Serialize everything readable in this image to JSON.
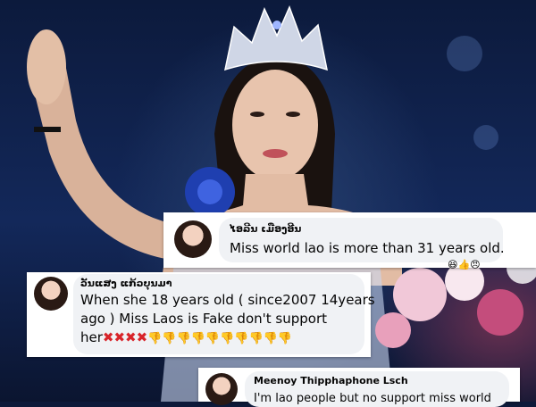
{
  "comments": [
    {
      "name": "ໄອລີນ ເມືອງອີນ",
      "text": "Miss world lao is more than 31 years old."
    },
    {
      "name": "ວັນແສງ ແກ້ວບຸນມາ",
      "text_line1": "When she 18 years old ( since2007 14years",
      "text_line2": "ago ) Miss Laos is Fake don't support",
      "text_line3": "her",
      "x_marks": "✖✖✖✖",
      "thumbs_down": "👎👎👎👎👎👎👎👎👎👎"
    },
    {
      "name": "Meenoy Thipphaphone Lsch",
      "text": "I'm lao people but no support miss world"
    }
  ],
  "icons": {
    "reaction_icons": [
      "haha-icon",
      "like-icon",
      "angry-icon"
    ]
  },
  "colors": {
    "bubble": "#f0f2f5",
    "x_mark": "#d8242a",
    "thumbs": "#f2b100"
  }
}
